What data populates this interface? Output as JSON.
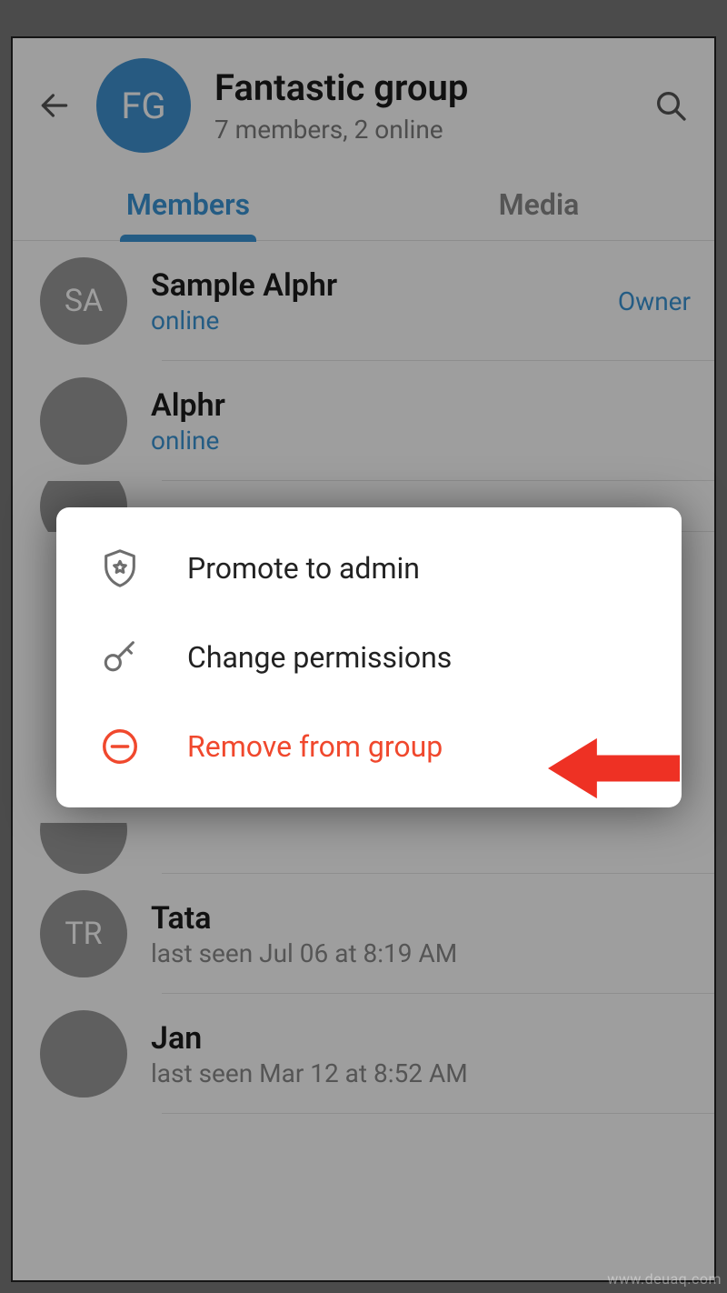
{
  "header": {
    "avatar_initials": "FG",
    "title": "Fantastic group",
    "subtitle": "7 members, 2 online"
  },
  "tabs": {
    "members": "Members",
    "media": "Media",
    "active": "members"
  },
  "members": [
    {
      "initials": "SA",
      "name": "Sample Alphr",
      "status": "online",
      "status_muted": false,
      "role": "Owner",
      "avatar_class": "av-pink"
    },
    {
      "initials": "",
      "name": "Alphr",
      "status": "online",
      "status_muted": false,
      "role": "",
      "avatar_class": "av-photo1"
    },
    {
      "initials": "",
      "name": "",
      "status": "",
      "status_muted": false,
      "role": "",
      "avatar_class": "av-red"
    },
    {
      "initials": "",
      "name": "",
      "status": "",
      "status_muted": false,
      "role": "",
      "avatar_class": "av-red"
    },
    {
      "initials": "TR",
      "name": "Tata",
      "status": "last seen Jul 06 at 8:19 AM",
      "status_muted": true,
      "role": "",
      "avatar_class": "av-teal"
    },
    {
      "initials": "",
      "name": "Jan",
      "status": "last seen Mar 12 at 8:52 AM",
      "status_muted": true,
      "role": "",
      "avatar_class": "av-photo2"
    }
  ],
  "dialog": {
    "promote": "Promote to admin",
    "permissions": "Change permissions",
    "remove": "Remove from group"
  },
  "colors": {
    "accent": "#3a95d5",
    "danger": "#f0482d"
  },
  "watermark": "www.deuaq.com"
}
